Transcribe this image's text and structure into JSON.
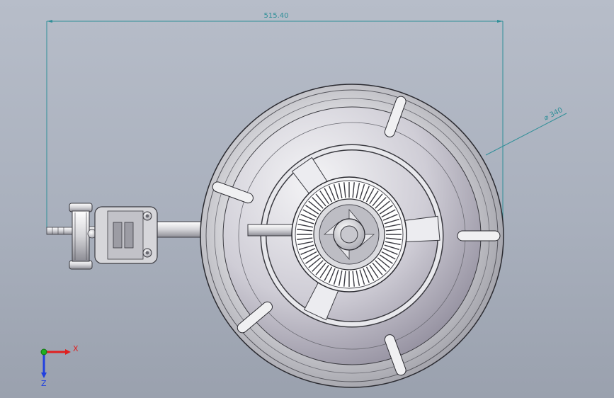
{
  "dimensions": {
    "width_label": "515.40",
    "diameter_label": "⌀ 340"
  },
  "triad": {
    "x_label": "X",
    "z_label": "Z"
  },
  "colors": {
    "background_top": "#b7bdc9",
    "background_bottom": "#9aa1ae",
    "dimension_line": "#2f8f98",
    "axis_x": "#e02020",
    "axis_y": "#20b020",
    "axis_z": "#2040e0"
  }
}
